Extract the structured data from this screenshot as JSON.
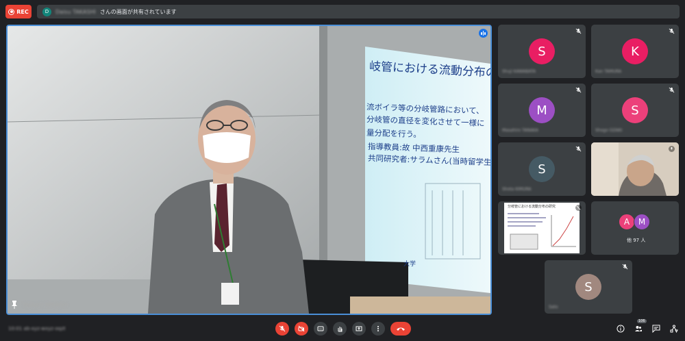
{
  "recording": {
    "label": "REC",
    "color": "#ea4335"
  },
  "share_banner": {
    "avatar_letter": "D",
    "presenter_name": "Daisu TAKASHI",
    "text": "さんの画面が共有されています"
  },
  "main_tile": {
    "presenter_name": "Takashi TAKASHI",
    "slide": {
      "title": "岐管における流動分布の研究",
      "lines": [
        "流ボイラ等の分岐管路において、",
        "分岐管の直径を変化させて一様に",
        "量分配を行う。",
        "指導教員:故 中西重康先生",
        "共同研究者:サラムさん(当時留学生)"
      ],
      "footer_lines": [
        "大学"
      ]
    }
  },
  "participants": [
    {
      "letter": "S",
      "name": "Shuji KAWABATA",
      "color": "#e91e63"
    },
    {
      "letter": "K",
      "name": "Kan TAMURA",
      "color": "#e91e63"
    },
    {
      "letter": "M",
      "name": "Masahiro TANAKA",
      "color": "#9c4fc4"
    },
    {
      "letter": "S",
      "name": "Shogo OZAKI",
      "color": "#ec407a"
    },
    {
      "letter": "S",
      "name": "Shota KIMURA",
      "color": "#455a64"
    },
    {
      "name": "Video participant"
    },
    {
      "name": "Shared slide participant",
      "slide_title": "分岐管における流動分布の研究"
    },
    {
      "letter": "S",
      "name": "Sato",
      "color": "#a1887f"
    }
  ],
  "others": {
    "letters": [
      "A",
      "M"
    ],
    "colors": [
      "#ec407a",
      "#9c4fc4"
    ],
    "label": "他 97 人"
  },
  "bottom_bar": {
    "meeting_info": "10:01   ab-xyz-wxyz-oqzt",
    "participant_count": "106"
  }
}
